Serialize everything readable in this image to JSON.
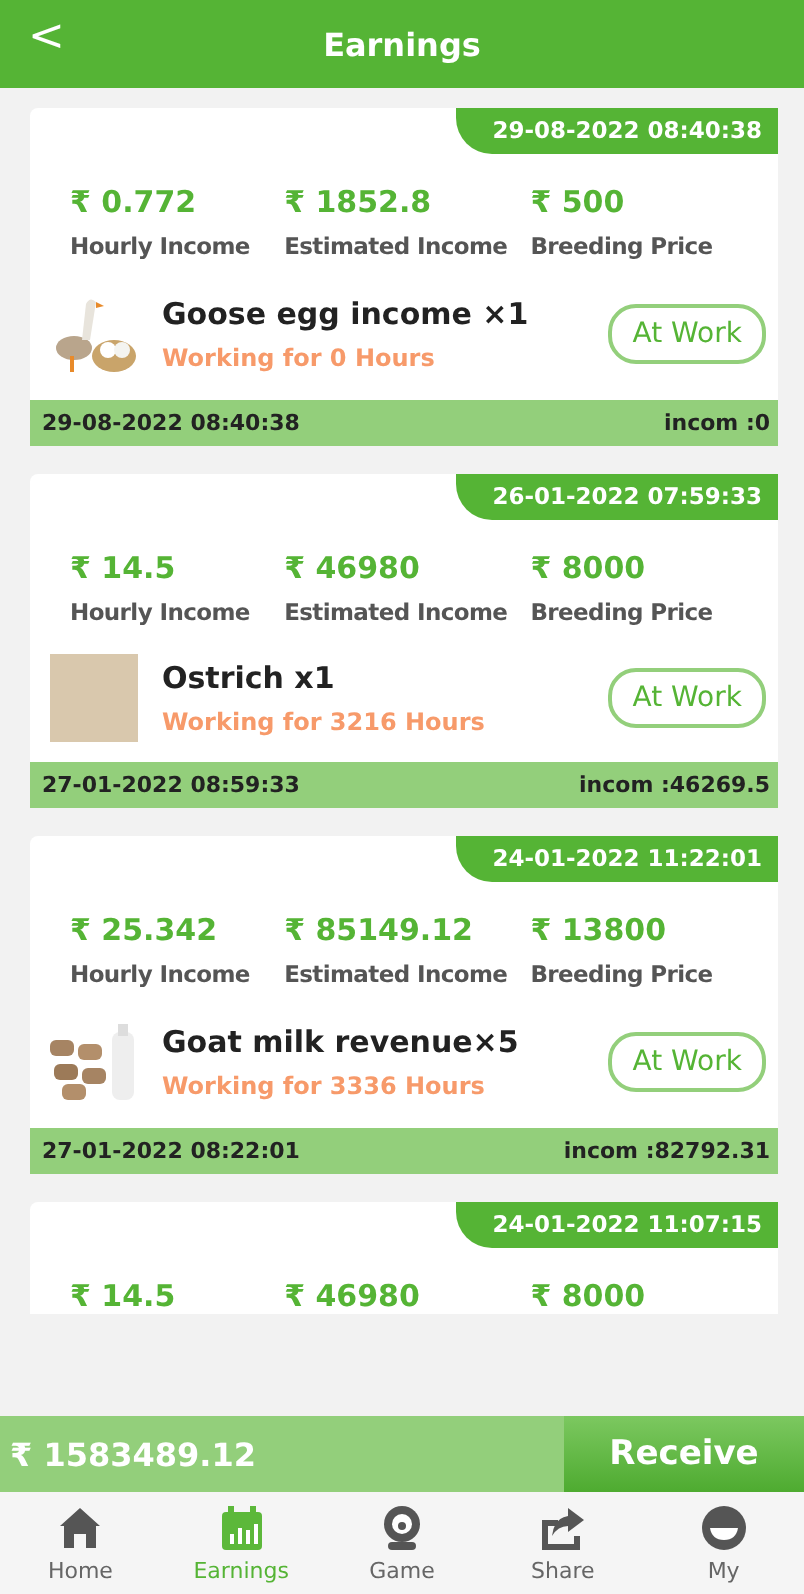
{
  "header": {
    "back_icon": "<",
    "title": "Earnings"
  },
  "cards": [
    {
      "tag": "29-08-2022 08:40:38",
      "stats": [
        {
          "value": "₹ 0.772",
          "label": "Hourly Income"
        },
        {
          "value": "₹ 1852.8",
          "label": "Estimated Income"
        },
        {
          "value": "₹ 500",
          "label": "Breeding Price"
        }
      ],
      "item": {
        "kind": "goose",
        "name": "Goose egg income ×1",
        "status": "Working for 0 Hours",
        "button": "At Work"
      },
      "footer": {
        "date": "29-08-2022 08:40:38",
        "income": "incom :0"
      }
    },
    {
      "tag": "26-01-2022 07:59:33",
      "stats": [
        {
          "value": "₹ 14.5",
          "label": "Hourly Income"
        },
        {
          "value": "₹ 46980",
          "label": "Estimated Income"
        },
        {
          "value": "₹ 8000",
          "label": "Breeding Price"
        }
      ],
      "item": {
        "kind": "placeholder",
        "name": "Ostrich x1",
        "status": "Working for 3216 Hours",
        "button": "At Work"
      },
      "footer": {
        "date": "27-01-2022 08:59:33",
        "income": "incom :46269.5"
      }
    },
    {
      "tag": "24-01-2022 11:22:01",
      "stats": [
        {
          "value": "₹ 25.342",
          "label": "Hourly Income"
        },
        {
          "value": "₹ 85149.12",
          "label": "Estimated Income"
        },
        {
          "value": "₹ 13800",
          "label": "Breeding Price"
        }
      ],
      "item": {
        "kind": "goat",
        "name": "Goat milk revenue×5",
        "status": "Working for 3336 Hours",
        "button": "At Work"
      },
      "footer": {
        "date": "27-01-2022 08:22:01",
        "income": "incom :82792.31"
      }
    },
    {
      "tag": "24-01-2022 11:07:15",
      "stats": [
        {
          "value": "₹ 14.5"
        },
        {
          "value": "₹ 46980"
        },
        {
          "value": "₹ 8000"
        }
      ]
    }
  ],
  "total": {
    "amount": "₹ 1583489.12",
    "button": "Receive"
  },
  "tabs": [
    {
      "kind": "home",
      "label": "Home",
      "selected": false
    },
    {
      "kind": "earnings",
      "label": "Earnings",
      "selected": true
    },
    {
      "kind": "game",
      "label": "Game",
      "selected": false
    },
    {
      "kind": "share",
      "label": "Share",
      "selected": false
    },
    {
      "kind": "my",
      "label": "My",
      "selected": false
    }
  ]
}
